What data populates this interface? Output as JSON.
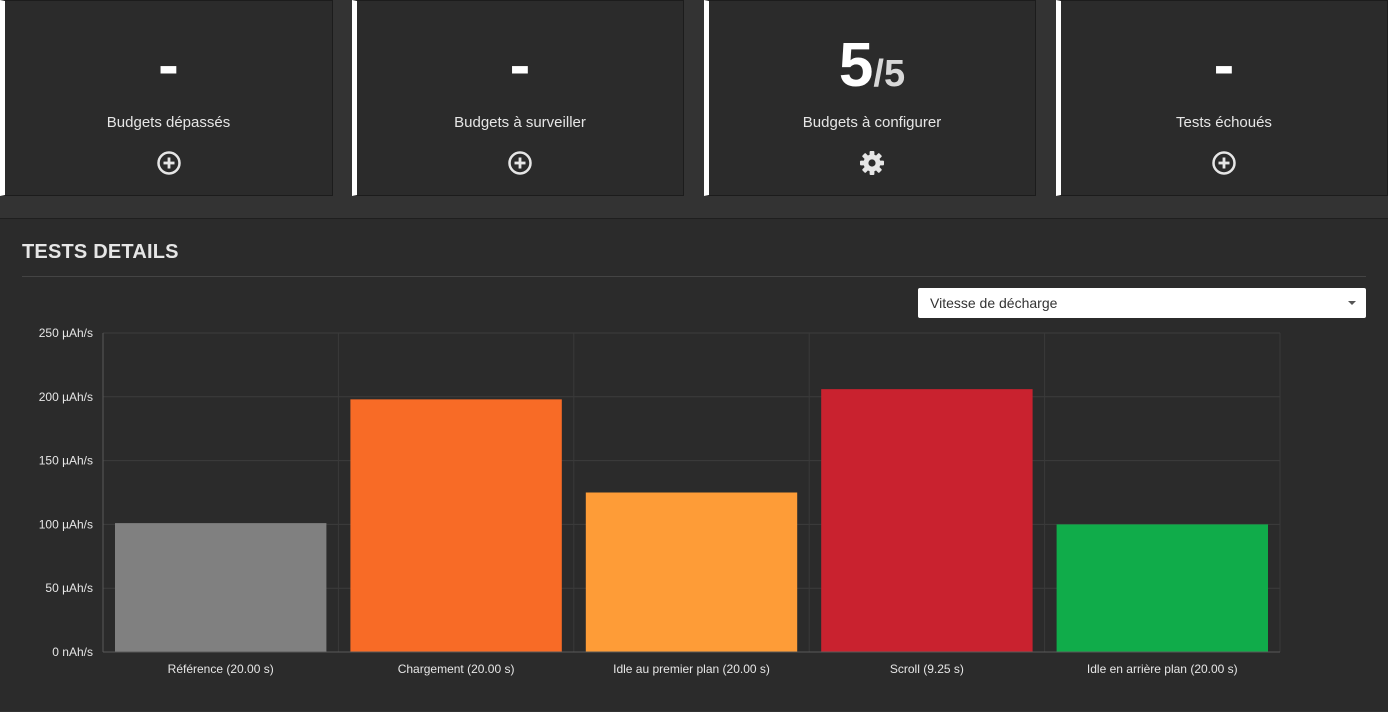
{
  "cards": [
    {
      "value": "-",
      "denominator": "",
      "label": "Budgets dépassés",
      "icon": "plus-circle-icon"
    },
    {
      "value": "-",
      "denominator": "",
      "label": "Budgets à surveiller",
      "icon": "plus-circle-icon"
    },
    {
      "value": "5",
      "denominator": "/5",
      "label": "Budgets à configurer",
      "icon": "gear-icon"
    },
    {
      "value": "-",
      "denominator": "",
      "label": "Tests échoués",
      "icon": "plus-circle-icon"
    }
  ],
  "panel": {
    "title": "TESTS DETAILS",
    "select_value": "Vitesse de décharge"
  },
  "chart_data": {
    "type": "bar",
    "categories": [
      "Référence (20.00 s)",
      "Chargement (20.00 s)",
      "Idle au premier plan (20.00 s)",
      "Scroll (9.25 s)",
      "Idle en arrière plan (20.00 s)"
    ],
    "values": [
      101,
      198,
      125,
      206,
      100
    ],
    "colors": [
      "#808080",
      "#f86b26",
      "#fe9c37",
      "#c9222f",
      "#10ac4a"
    ],
    "yticks": [
      "0 nAh/s",
      "50 µAh/s",
      "100 µAh/s",
      "150 µAh/s",
      "200 µAh/s",
      "250 µAh/s"
    ],
    "ytick_values": [
      0,
      50,
      100,
      150,
      200,
      250
    ],
    "ylim": [
      0,
      250
    ],
    "grid": true
  }
}
